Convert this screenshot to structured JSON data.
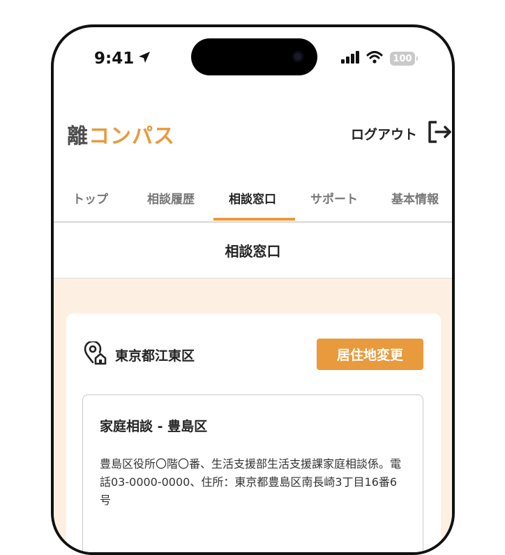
{
  "status_bar": {
    "time": "9:41",
    "battery": "100"
  },
  "header": {
    "logo_part1": "離",
    "logo_part2": "コンパス",
    "logout_label": "ログアウト"
  },
  "tabs": [
    {
      "label": "トップ"
    },
    {
      "label": "相談履歴"
    },
    {
      "label": "相談窓口"
    },
    {
      "label": "サポート"
    },
    {
      "label": "基本情報"
    }
  ],
  "active_tab": "相談窓口",
  "page_title": "相談窓口",
  "area": {
    "name": "東京都江東区",
    "change_button": "居住地変更"
  },
  "office": {
    "title": "家庭相談 - 豊島区",
    "description": "豊島区役所〇階〇番、生活支援部生活支援課家庭相談係。電話03-0000-0000、住所：東京都豊島区南長崎3丁目16番6号"
  },
  "colors": {
    "accent": "#e89a3c",
    "content_bg": "#fdf0e3"
  }
}
